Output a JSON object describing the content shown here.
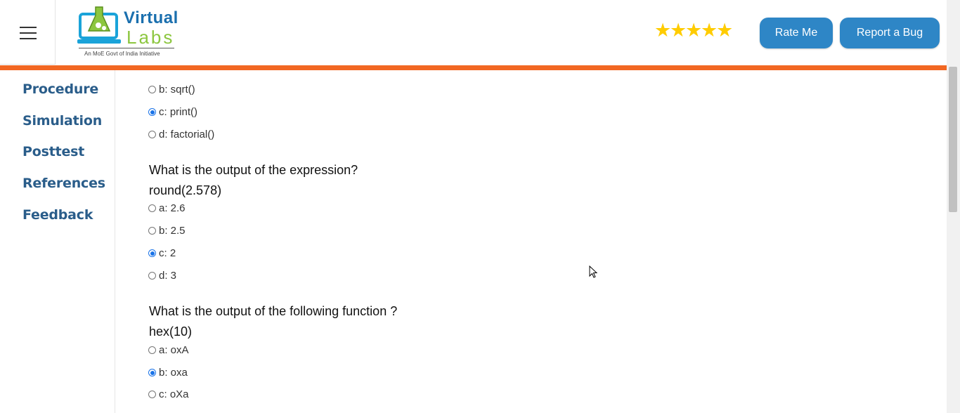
{
  "header": {
    "logo": {
      "title_1": "Virtual",
      "title_2": "Labs",
      "tagline": "An MoE Govt of India Initiative"
    },
    "rating_stars": 5,
    "rate_button": "Rate Me",
    "bug_button": "Report a Bug"
  },
  "sidebar": {
    "items": [
      {
        "label": "Procedure"
      },
      {
        "label": "Simulation"
      },
      {
        "label": "Posttest"
      },
      {
        "label": "References"
      },
      {
        "label": "Feedback"
      }
    ]
  },
  "quiz": {
    "q0_options": [
      {
        "label": "b: sqrt()",
        "checked": false
      },
      {
        "label": "c: print()",
        "checked": true
      },
      {
        "label": "d: factorial()",
        "checked": false
      }
    ],
    "q1": {
      "line1": "What is the output of the expression?",
      "line2": "round(2.578)",
      "options": [
        {
          "label": "a: 2.6",
          "checked": false
        },
        {
          "label": "b: 2.5",
          "checked": false
        },
        {
          "label": "c: 2",
          "checked": true
        },
        {
          "label": "d: 3",
          "checked": false
        }
      ]
    },
    "q2": {
      "line1": "What is the output of the following function ?",
      "line2": "hex(10)",
      "options": [
        {
          "label": "a: oxA",
          "checked": false
        },
        {
          "label": "b: oxa",
          "checked": true
        },
        {
          "label": "c: oXa",
          "checked": false
        }
      ]
    }
  },
  "colors": {
    "accent_orange": "#f26722",
    "button_blue": "#2e86c6",
    "sidebar_text": "#2a5d8a",
    "star": "#ffcc00"
  }
}
